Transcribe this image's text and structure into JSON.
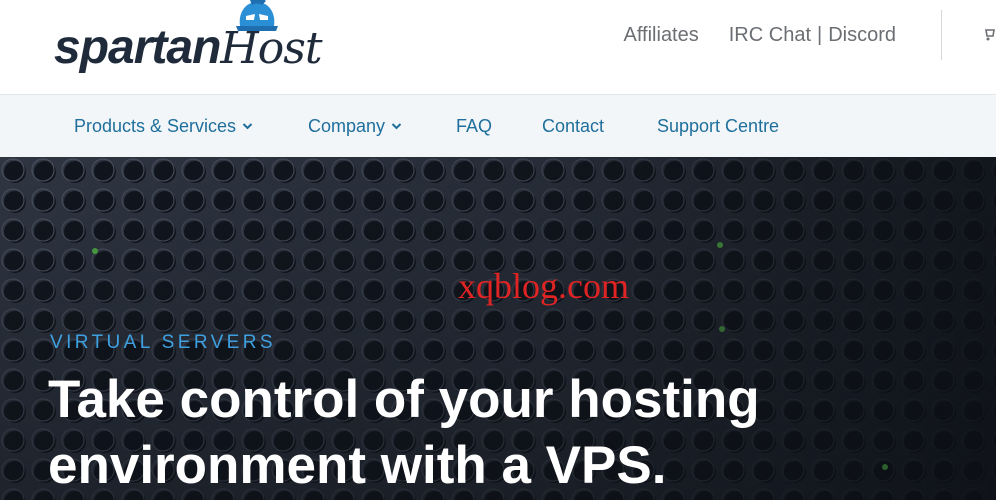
{
  "brand": {
    "logo_main": "spartan",
    "logo_script": "Host"
  },
  "top_links": {
    "affiliates": "Affiliates",
    "irc_chat": "IRC Chat",
    "separator": "|",
    "discord": "Discord"
  },
  "nav": {
    "items": [
      {
        "label": "Products & Services",
        "has_dropdown": true
      },
      {
        "label": "Company",
        "has_dropdown": true
      },
      {
        "label": "FAQ",
        "has_dropdown": false
      },
      {
        "label": "Contact",
        "has_dropdown": false
      },
      {
        "label": "Support Centre",
        "has_dropdown": false
      }
    ]
  },
  "hero": {
    "watermark": "xqblog.com",
    "eyebrow": "VIRTUAL SERVERS",
    "headline_line1": "Take control of your hosting",
    "headline_line2": "environment with a VPS."
  },
  "icons": {
    "dropdown": "chevron-down-icon",
    "mascot": "spartan-helmet-icon",
    "cart": "cart-icon"
  },
  "colors": {
    "nav_text": "#1f6f9c",
    "eyebrow": "#3ea0e0",
    "watermark": "#e02424",
    "logo_dark": "#1f2a3a",
    "logo_accent": "#2b8fd6"
  }
}
